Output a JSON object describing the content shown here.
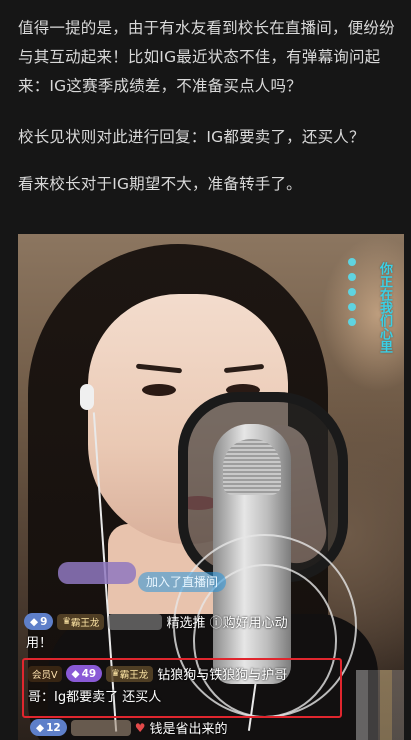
{
  "article": {
    "para1": "值得一提的是，由于有水友看到校长在直播间，便纷纷与其互动起来！比如IG最近状态不佳，有弹幕询问起来：IG这赛季成绩差，不准备买点人吗？",
    "para2": "校长见状则对此进行回复：IG都要卖了，还买人？",
    "para3": "看来校长对于IG期望不大，准备转手了。"
  },
  "stream": {
    "side_caption": "你正在我们心里",
    "join_notice": "加入了直播间",
    "messages": [
      {
        "level": "9",
        "club": "霸王龙",
        "text_top": "精选推 ⓘ购好用心动",
        "text_bottom": "用！"
      },
      {
        "vip": "会员V",
        "level": "49",
        "club": "霸王龙",
        "name": "钻狼狗与铁狼狗与护哥",
        "text": "哥：Ig都要卖了 还买人"
      },
      {
        "level": "12",
        "text": "钱是省出来的"
      }
    ]
  },
  "colors": {
    "highlight_border": "#e0262e",
    "caption": "#3ad0e6"
  }
}
